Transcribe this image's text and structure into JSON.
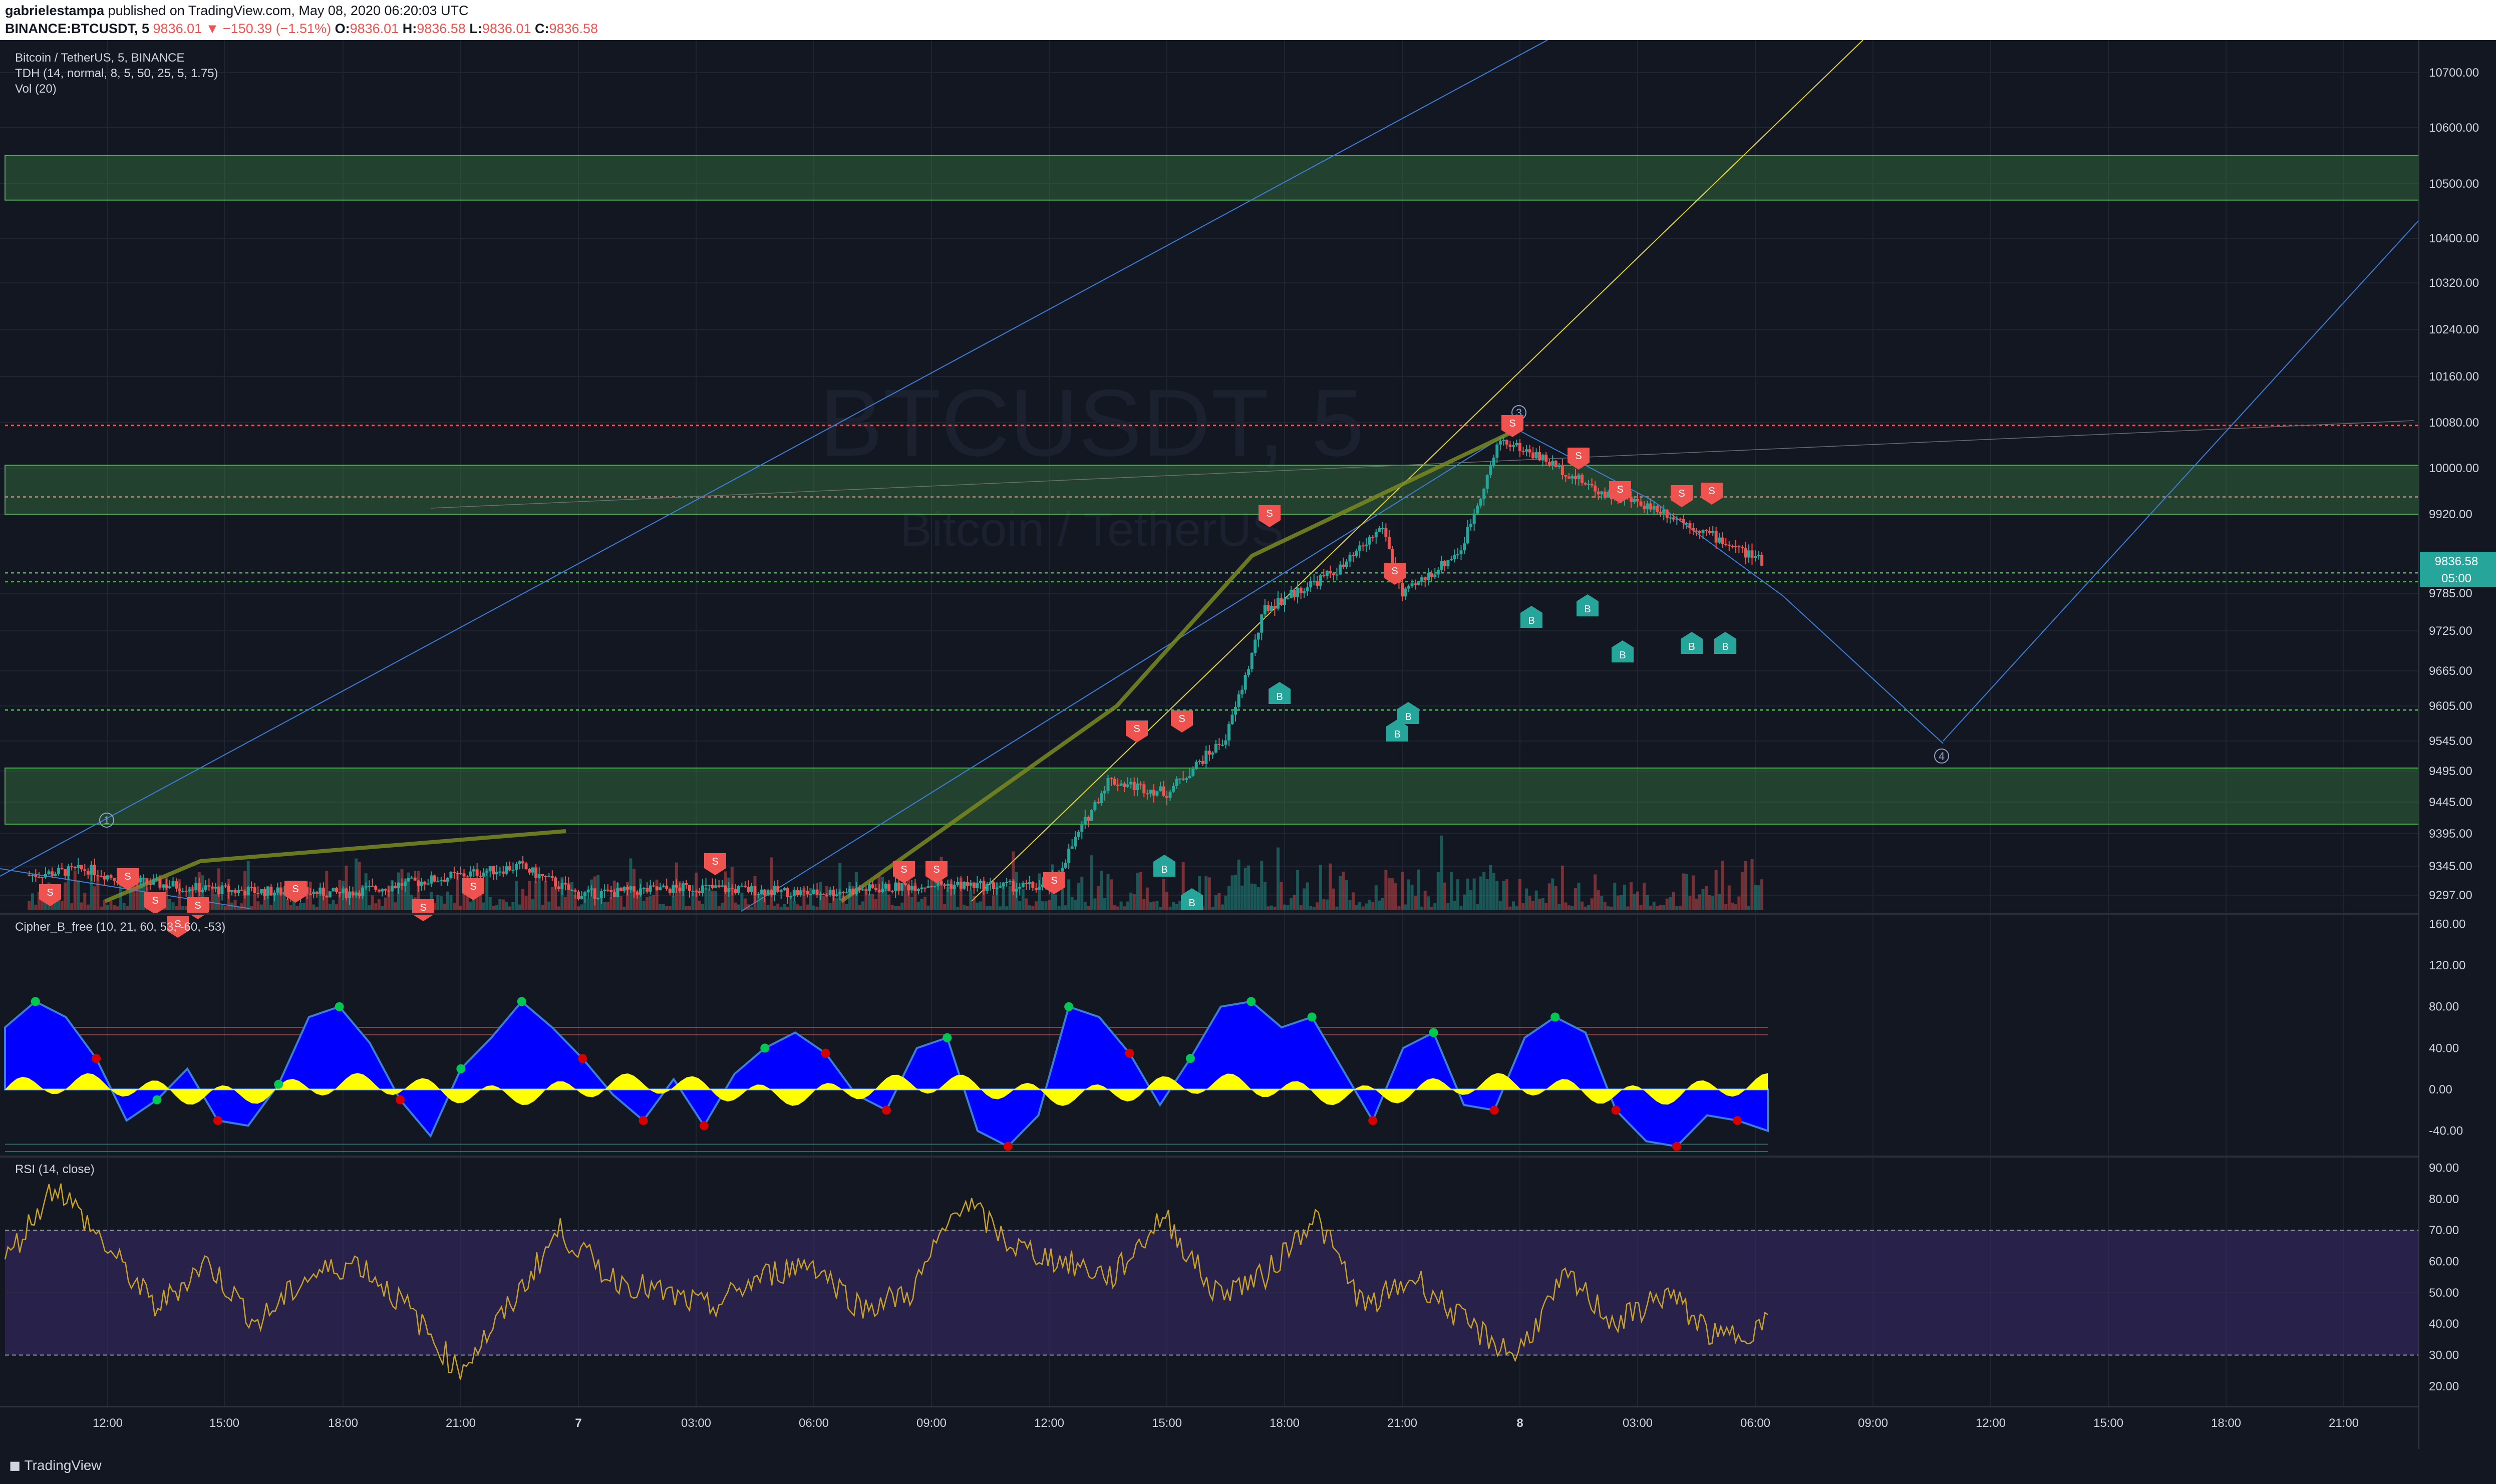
{
  "header": {
    "author": "gabrielestampa",
    "published_text": "published on TradingView.com, May 08, 2020 06:20:03 UTC",
    "symbol": "BINANCE:BTCUSDT, 5",
    "change": "−150.39 (−1.51%)",
    "o_label": "O:",
    "o_value": "9836.01",
    "h_label": "H:",
    "h_value": "9836.58",
    "l_label": "L:",
    "l_value": "9836.01",
    "c_label": "C:",
    "c_value": "9836.58",
    "last_price": "9836.01"
  },
  "legend": {
    "title": "Bitcoin / TetherUS, 5, BINANCE",
    "tdh": "TDH (14, normal, 8, 5, 50, 25, 5, 1.75)",
    "vol": "Vol (20)",
    "cipher": "Cipher_B_free (10, 21, 60, 53, -60, -53)",
    "rsi": "RSI (14, close)"
  },
  "watermark": {
    "big": "BTCUSDT, 5",
    "small": "Bitcoin / TetherUS"
  },
  "price_badge": {
    "price": "9836.58",
    "countdown": "05:00"
  },
  "footer": {
    "logo": "TradingView"
  },
  "colors": {
    "bg": "#131722",
    "up": "#26a69a",
    "down": "#ef5350",
    "zone": "#4caf50",
    "cipher_blue": "#0000ff",
    "cipher_yellow": "#ffff00",
    "rsi_line": "#c9a227",
    "rsi_band": "#3a2a6b"
  },
  "chart_data": [
    {
      "type": "candlestick",
      "title": "Bitcoin / TetherUS, 5, BINANCE",
      "x_ticks": [
        "12:00",
        "15:00",
        "18:00",
        "21:00",
        "7",
        "03:00",
        "06:00",
        "09:00",
        "12:00",
        "15:00",
        "18:00",
        "21:00",
        "8",
        "03:00",
        "06:00",
        "09:00",
        "12:00",
        "15:00",
        "18:00",
        "21:00"
      ],
      "y_ticks": [
        "10700.00",
        "10600.00",
        "10500.00",
        "10400.00",
        "10320.00",
        "10240.00",
        "10160.00",
        "10080.00",
        "10000.00",
        "9920.00",
        "9785.00",
        "9725.00",
        "9665.00",
        "9605.00",
        "9545.00",
        "9495.00",
        "9445.00",
        "9395.00",
        "9345.00",
        "9297.00"
      ],
      "ylim": [
        9280,
        10740
      ],
      "price_path": [
        {
          "t": "10:00",
          "p": 9330
        },
        {
          "t": "11:30",
          "p": 9340
        },
        {
          "t": "12:30",
          "p": 9320
        },
        {
          "t": "15:00",
          "p": 9305
        },
        {
          "t": "18:00",
          "p": 9300
        },
        {
          "t": "21:00",
          "p": 9330
        },
        {
          "t": "22:30",
          "p": 9345
        },
        {
          "t": "7 00:00",
          "p": 9298
        },
        {
          "t": "03:00",
          "p": 9310
        },
        {
          "t": "06:00",
          "p": 9300
        },
        {
          "t": "09:00",
          "p": 9315
        },
        {
          "t": "12:00",
          "p": 9310
        },
        {
          "t": "13:30",
          "p": 9480
        },
        {
          "t": "15:00",
          "p": 9460
        },
        {
          "t": "16:30",
          "p": 9550
        },
        {
          "t": "17:30",
          "p": 9760
        },
        {
          "t": "19:30",
          "p": 9830
        },
        {
          "t": "20:30",
          "p": 9900
        },
        {
          "t": "21:00",
          "p": 9780
        },
        {
          "t": "22:30",
          "p": 9860
        },
        {
          "t": "23:30",
          "p": 10050
        },
        {
          "t": "8 00:30",
          "p": 10020
        },
        {
          "t": "02:00",
          "p": 9960
        },
        {
          "t": "03:30",
          "p": 9930
        },
        {
          "t": "05:00",
          "p": 9880
        },
        {
          "t": "06:15",
          "p": 9836.58
        }
      ],
      "zones": [
        [
          10470,
          10550
        ],
        [
          9920,
          10005
        ],
        [
          9410,
          9500
        ]
      ],
      "hlines": [
        {
          "price": 10075,
          "style": "dashed",
          "color": "#ef5350"
        },
        {
          "price": 9950,
          "style": "dashed",
          "color": "#ef5350"
        },
        {
          "price": 9820,
          "style": "dashed",
          "color": "#4caf50"
        },
        {
          "price": 9805,
          "style": "dashed",
          "color": "#4caf50"
        },
        {
          "price": 9598,
          "style": "dashed",
          "color": "#4caf50"
        }
      ],
      "wave_labels": [
        "1",
        "3",
        "4"
      ],
      "signals": {
        "sell": "S",
        "buy": "B"
      }
    },
    {
      "type": "area",
      "title": "Cipher_B_free (10, 21, 60, 53, -60, -53)",
      "y_ticks": [
        "160.00",
        "120.00",
        "80.00",
        "40.00",
        "0.00",
        "-40.00"
      ],
      "ylim": [
        -60,
        165
      ]
    },
    {
      "type": "line",
      "title": "RSI (14, close)",
      "y_ticks": [
        "90.00",
        "80.00",
        "70.00",
        "60.00",
        "50.00",
        "40.00",
        "30.00",
        "20.00"
      ],
      "ylim": [
        15,
        92
      ],
      "bands": [
        30,
        70
      ],
      "approx_values": [
        60,
        85,
        65,
        45,
        60,
        40,
        55,
        60,
        45,
        25,
        45,
        70,
        55,
        50,
        45,
        55,
        60,
        45,
        50,
        80,
        65,
        60,
        55,
        75,
        50,
        55,
        75,
        45,
        55,
        40,
        30,
        55,
        40,
        50,
        35,
        40
      ]
    }
  ]
}
